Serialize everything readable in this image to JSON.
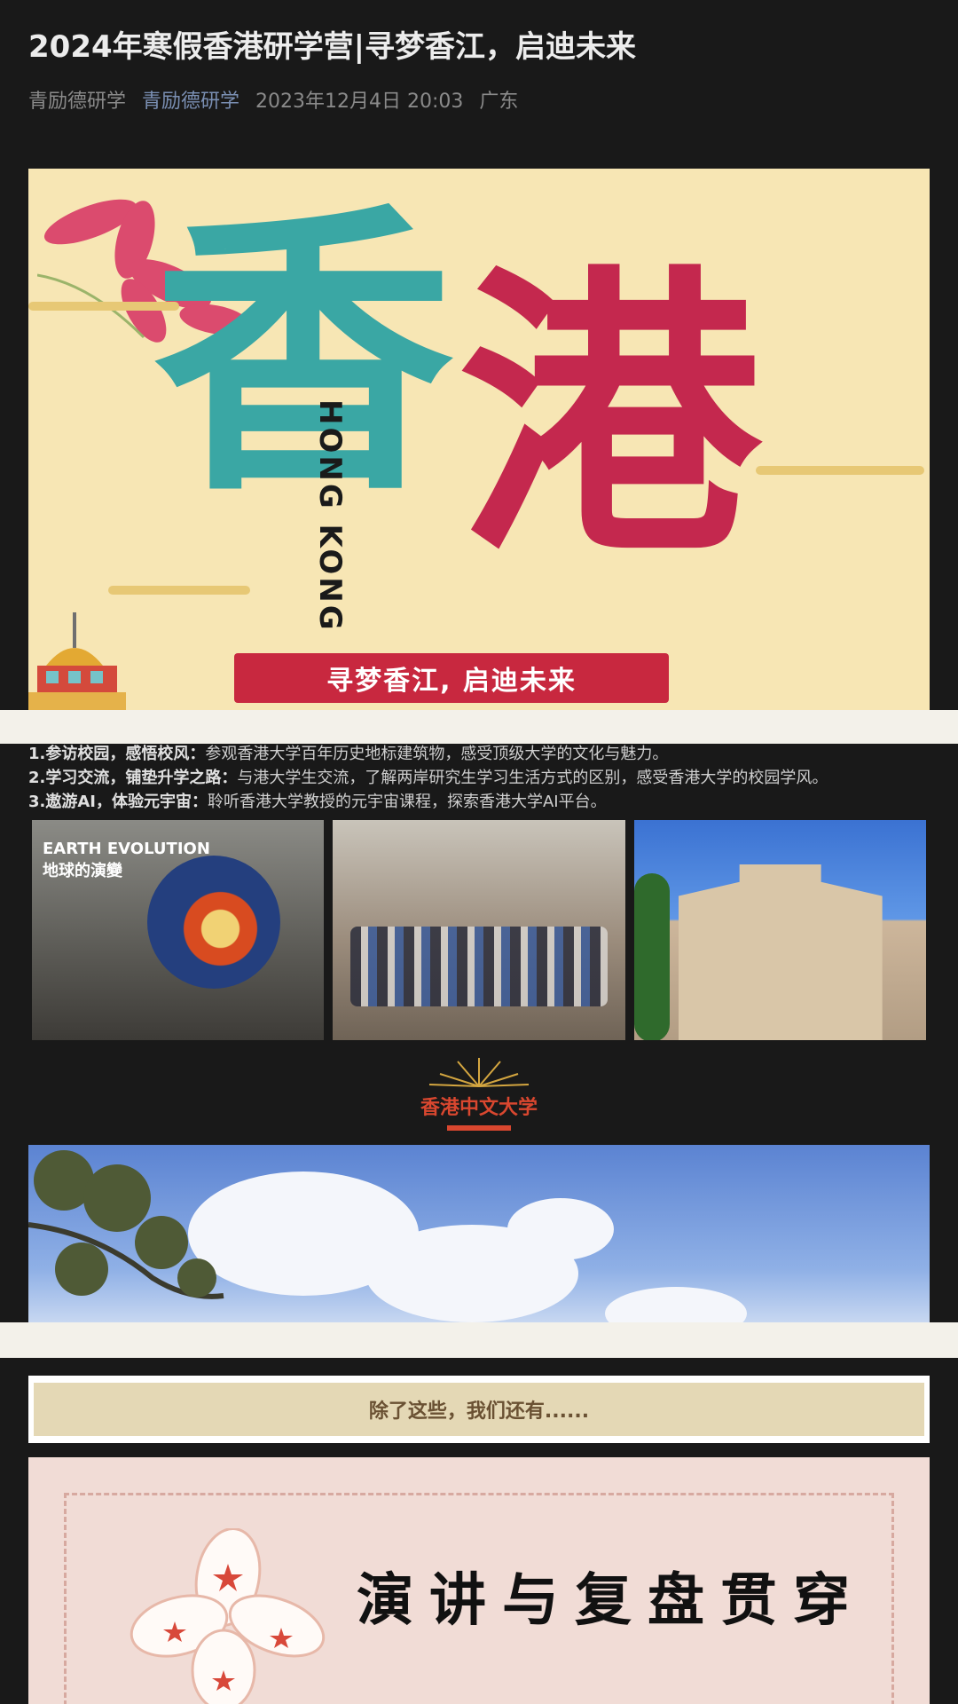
{
  "article": {
    "title": "2024年寒假香港研学营|寻梦香江，启迪未来",
    "author": "青励德研学",
    "account": "青励德研学",
    "date": "2023年12月4日 20:03",
    "location": "广东"
  },
  "hero": {
    "char1": "香",
    "char2": "港",
    "english": "HONG KONG",
    "slogan": "寻梦香江, 启迪未来"
  },
  "bullets": [
    {
      "label": "1.参访校园，感悟校风：",
      "text": "参观香港大学百年历史地标建筑物，感受顶级大学的文化与魅力。"
    },
    {
      "label": "2.学习交流，铺垫升学之路：",
      "text": "与港大学生交流，了解两岸研究生学习生活方式的区别，感受香港大学的校园学风。"
    },
    {
      "label": "3.遨游AI，体验元宇宙：",
      "text": "聆听香港大学教授的元宇宙课程，探索香港大学AI平台。"
    }
  ],
  "photos": {
    "photo1_sign": "EARTH EVOLUTION\n地球的演變"
  },
  "section": {
    "title": "香港中文大学"
  },
  "paper_banner": {
    "text": "除了这些，我们还有......"
  },
  "poster": {
    "headline": "演讲与复盘贯穿"
  },
  "colors": {
    "background": "#191919",
    "accent_red": "#d9472f",
    "hero_bg": "#f7e6b4",
    "teal": "#3aa7a4",
    "crimson": "#c4284e"
  }
}
